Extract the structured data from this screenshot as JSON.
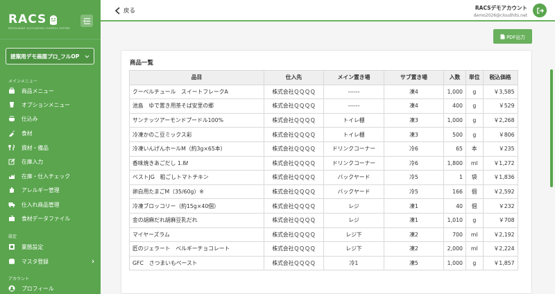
{
  "brand": {
    "name": "RACS",
    "subtitle": "RESTAURANT ACCOUNTING CONTROL SYSTEM"
  },
  "sidebar": {
    "org_select": "提案用デモ画面プロ_フルOP",
    "section_main": "メインメニュー",
    "items": [
      {
        "label": "商品メニュー",
        "icon": "product-menu-icon"
      },
      {
        "label": "オプションメニュー",
        "icon": "option-menu-icon"
      },
      {
        "label": "仕込み",
        "icon": "prep-icon"
      },
      {
        "label": "食材",
        "icon": "ingredient-icon"
      },
      {
        "label": "資材・備品",
        "icon": "supplies-icon"
      },
      {
        "label": "在庫入力",
        "icon": "stock-input-icon"
      },
      {
        "label": "在庫・仕入チェック",
        "icon": "stock-check-icon"
      },
      {
        "label": "アレルギー管理",
        "icon": "allergy-icon"
      },
      {
        "label": "仕入れ商品管理",
        "icon": "purchase-icon"
      },
      {
        "label": "食材データファイル",
        "icon": "data-file-icon"
      }
    ],
    "section_settings": "設定",
    "settings_items": [
      {
        "label": "業態設定",
        "icon": "business-icon"
      },
      {
        "label": "マスタ登録",
        "icon": "master-icon"
      }
    ],
    "section_account": "アカウント",
    "account_items": [
      {
        "label": "プロフィール",
        "icon": "profile-icon"
      }
    ]
  },
  "header": {
    "back_label": "戻る",
    "account_name": "RACSデモアカウント",
    "account_email": "demo2026@cloudhits.net"
  },
  "main": {
    "pdf_button": "PDF出力",
    "card_title": "商品一覧",
    "columns": [
      "品目",
      "仕入先",
      "メイン置き場",
      "サブ置き場",
      "入数",
      "単位",
      "税込価格"
    ],
    "rows": [
      [
        "クーベルチュール　スイートフレークA",
        "株式会社ＱＱＱＱ",
        "------",
        "凍4",
        "1,000",
        "g",
        "￥3,585"
      ],
      [
        "池島　ゆで置き用茶そば安里の郷",
        "株式会社ＱＱＱＱ",
        "------",
        "凍4",
        "400",
        "g",
        "￥529"
      ],
      [
        "サンナッツアーモンドプードル100%",
        "株式会社ＱＱＱＱ",
        "トイレ棚",
        "凍3",
        "1,000",
        "g",
        "￥2,268"
      ],
      [
        "冷凍かのこ豆ミックス彩",
        "株式会社ＱＱＱＱ",
        "トイレ棚",
        "凍3",
        "500",
        "g",
        "￥806"
      ],
      [
        "冷凍いんげんホールM（約3g×65本）",
        "株式会社ＱＱＱＱ",
        "ドリンクコーナー",
        "冷6",
        "65",
        "本",
        "￥235"
      ],
      [
        "香味焼きあごだし 1.8ℓ",
        "株式会社ＱＱＱＱ",
        "ドリンクコーナー",
        "冷6",
        "1,800",
        "ml",
        "￥1,272"
      ],
      [
        "ベストJG　粗ごしトマトチキン",
        "株式会社ＱＱＱＱ",
        "バックヤード",
        "冷5",
        "1",
        "袋",
        "￥1,836"
      ],
      [
        "卵白用たまごM（35/60g）※",
        "株式会社ＱＱＱＱ",
        "バックヤード",
        "冷5",
        "166",
        "個",
        "￥2,592"
      ],
      [
        "冷凍ブロッコリー（約15g×40個）",
        "株式会社ＱＱＱＱ",
        "レジ",
        "凍1",
        "40",
        "個",
        "￥232"
      ],
      [
        "金の胡麻だれ胡麻豆乳だれ",
        "株式会社ＱＱＱＱ",
        "レジ",
        "凍1",
        "1,010",
        "g",
        "￥708"
      ],
      [
        "マイヤーズラム",
        "株式会社ＱＱＱＱ",
        "レジ下",
        "凍2",
        "700",
        "ml",
        "￥2,192"
      ],
      [
        "匠のジェラート　ベルギーチョコレート",
        "株式会社ＱＱＱＱ",
        "レジ下",
        "凍2",
        "2,000",
        "ml",
        "￥2,224"
      ],
      [
        "GFC　さつまいもペースト",
        "株式会社ＱＱＱＱ",
        "冷1",
        "凍5",
        "1,000",
        "g",
        "￥1,857"
      ]
    ]
  },
  "colors": {
    "sidebar": "#5aa54e",
    "accent": "#6ab15e"
  }
}
